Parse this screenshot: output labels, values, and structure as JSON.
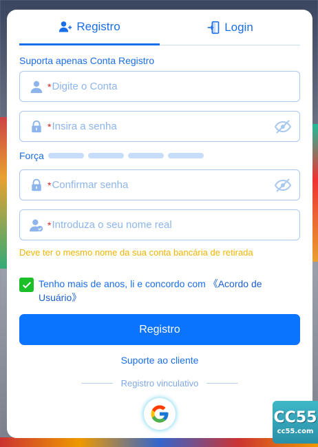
{
  "tabs": [
    {
      "label": "Registro",
      "icon": "add-user-icon",
      "active": true
    },
    {
      "label": "Login",
      "icon": "login-door-icon",
      "active": false
    }
  ],
  "hint": "Suporta apenas Conta Registro",
  "fields": {
    "account": {
      "placeholder": "Digite o Conta",
      "required": "*",
      "icon": "user-icon"
    },
    "password": {
      "placeholder": "Insira a senha",
      "required": "*",
      "icon": "lock-icon"
    },
    "confirm": {
      "placeholder": "Confirmar senha",
      "required": "*",
      "icon": "lock-icon"
    },
    "realname": {
      "placeholder": "Introduza o seu nome real",
      "required": "*",
      "icon": "verified-user-icon"
    }
  },
  "strength_label": "Força",
  "warning": "Deve ter o mesmo nome da sua conta bancária de retirada",
  "agreement": {
    "checked": true,
    "text": "Tenho mais de anos, li e concordo com ",
    "link": "《Acordo de Usuário》"
  },
  "submit_label": "Registro",
  "support_label": "Suporte ao cliente",
  "divider_label": "Registro vinculativo",
  "badge": {
    "big": "CC55",
    "small": "cc55.com"
  },
  "colors": {
    "accent": "#1a6ee8",
    "button": "#0a74ff",
    "check": "#1bbf2a",
    "warning": "#f0b400"
  }
}
